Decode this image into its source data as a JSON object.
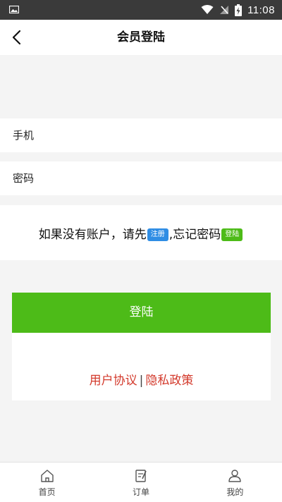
{
  "status_bar": {
    "time": "11:08"
  },
  "header": {
    "title": "会员登陆"
  },
  "form": {
    "phone_label": "手机",
    "password_label": "密码"
  },
  "prompt": {
    "text_before": "如果没有账户，请先",
    "register_tag": "注册",
    "text_middle": ",忘记密码",
    "login_tag": "登陆"
  },
  "actions": {
    "login_button": "登陆"
  },
  "links": {
    "user_agreement": "用户协议",
    "separator": "|",
    "privacy_policy": "隐私政策"
  },
  "tabbar": {
    "items": [
      {
        "label": "首页",
        "icon": "home-icon"
      },
      {
        "label": "订单",
        "icon": "order-icon"
      },
      {
        "label": "我的",
        "icon": "user-icon"
      }
    ]
  },
  "colors": {
    "primary_green": "#4dbb18",
    "register_tag_blue": "#2f8de4",
    "login_tag_green": "#4dbb18",
    "link_red": "#d33a2c"
  }
}
